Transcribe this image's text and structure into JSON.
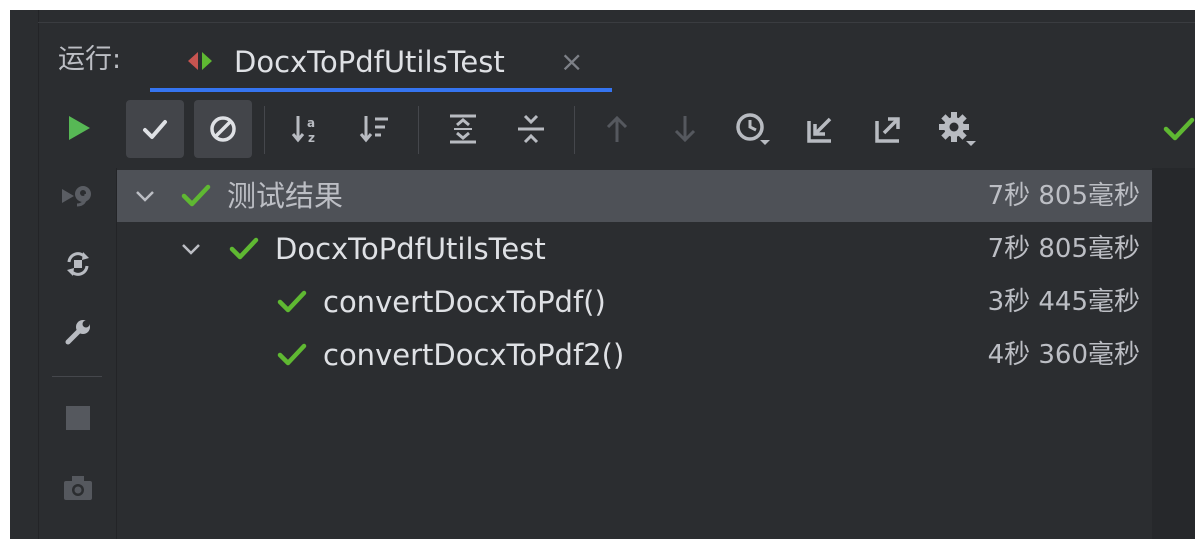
{
  "run_label": "运行:",
  "tab": {
    "title": "DocxToPdfUtilsTest",
    "close": "×"
  },
  "colors": {
    "pass_green": "#5fb832",
    "run_green": "#57b855",
    "accent_blue": "#3574f0",
    "panel_bg": "#2b2d30",
    "selected_row": "#4e5157"
  },
  "left_toolbar": [
    {
      "name": "rerun-icon"
    },
    {
      "name": "rerun-failed-icon"
    },
    {
      "name": "toggle-auto-test-icon"
    },
    {
      "name": "settings-wrench-icon"
    },
    {
      "name": "stop-icon"
    },
    {
      "name": "camera-icon"
    }
  ],
  "top_toolbar": [
    {
      "name": "show-passed-icon",
      "toggled": true
    },
    {
      "name": "show-ignored-icon",
      "toggled": true
    },
    {
      "name": "sort-alphabetically-icon"
    },
    {
      "name": "sort-by-duration-icon"
    },
    {
      "name": "expand-all-icon"
    },
    {
      "name": "collapse-all-icon"
    },
    {
      "name": "previous-test-icon"
    },
    {
      "name": "next-test-icon"
    },
    {
      "name": "test-history-icon"
    },
    {
      "name": "import-tests-icon"
    },
    {
      "name": "export-tests-icon"
    },
    {
      "name": "settings-gear-icon"
    }
  ],
  "tree": [
    {
      "label": "测试结果",
      "time": "7秒 805毫秒",
      "level": 0,
      "expandable": true,
      "selected": true
    },
    {
      "label": "DocxToPdfUtilsTest",
      "time": "7秒 805毫秒",
      "level": 1,
      "expandable": true,
      "selected": false
    },
    {
      "label": "convertDocxToPdf()",
      "time": "3秒 445毫秒",
      "level": 2,
      "expandable": false,
      "selected": false
    },
    {
      "label": "convertDocxToPdf2()",
      "time": "4秒 360毫秒",
      "level": 2,
      "expandable": false,
      "selected": false
    }
  ]
}
